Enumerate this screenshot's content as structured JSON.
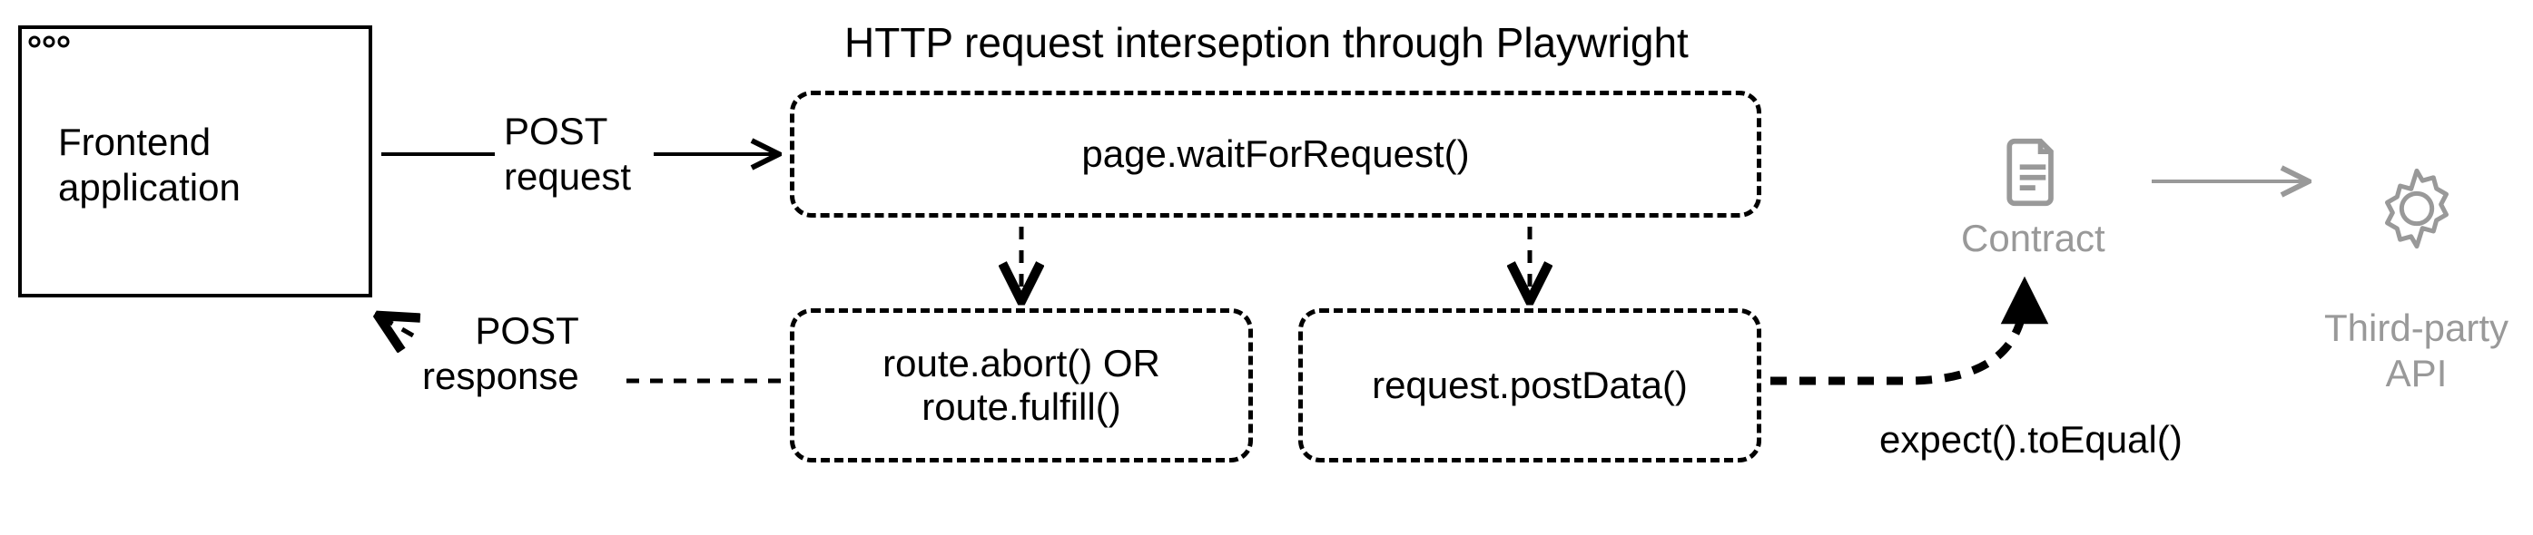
{
  "nodes": {
    "frontend": "Frontend\napplication",
    "title": "HTTP request interseption through Playwright",
    "waitForRequest": "page.waitForRequest()",
    "abortFulfill": "route.abort() OR\nroute.fulfill()",
    "postData": "request.postData()",
    "contract": "Contract",
    "thirdParty": "Third-party\nAPI"
  },
  "edges": {
    "postRequest": "POST\nrequest",
    "postResponse": "POST\nresponse",
    "expect": "expect().toEqual()"
  }
}
